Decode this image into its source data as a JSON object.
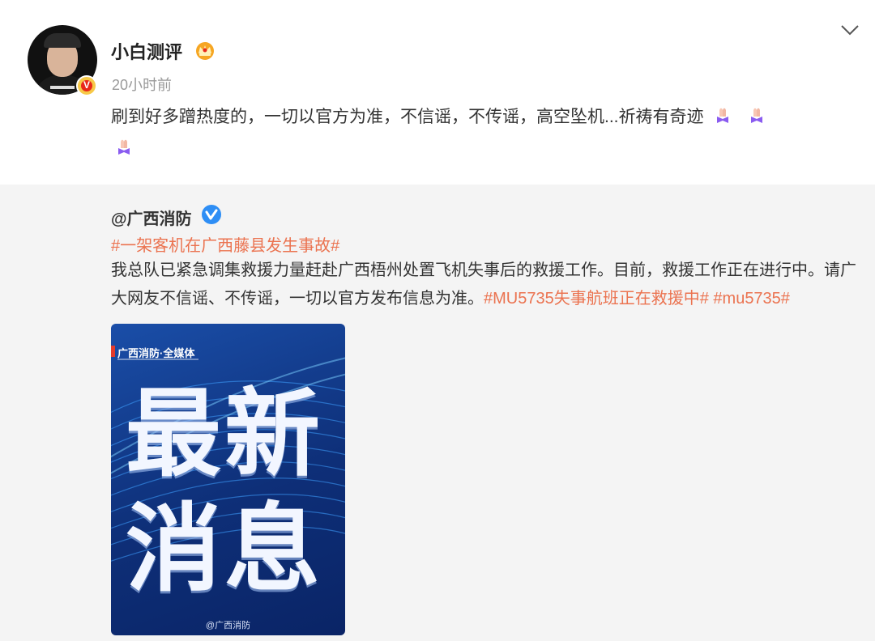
{
  "post": {
    "author_name": "小白测评",
    "timestamp": "20小时前",
    "text_part1": "刷到好多蹭热度的，一切以官方为准，不信谣，不传谣，高空坠机...祈祷有奇迹",
    "badge_letter": "V"
  },
  "repost": {
    "author_name": "@广西消防",
    "topic": "#一架客机在广西藤县发生事故#",
    "text": "我总队已紧急调集救援力量赶赴广西梧州处置飞机失事后的救援工作。目前，救援工作正在进行中。请广大网友不信谣、不传谣，一切以官方发布信息为准。",
    "hashtag1": "#MU5735失事航班正在救援中#",
    "hashtag2": "#mu5735#",
    "image": {
      "brand": "广西消防·全媒体",
      "headline_line1": "最新",
      "headline_line2": "消息",
      "watermark": "@广西消防"
    }
  },
  "colors": {
    "link_orange": "#eb7350",
    "repost_bg": "#f4f4f4",
    "verified_blue": "#2e8ef5"
  }
}
